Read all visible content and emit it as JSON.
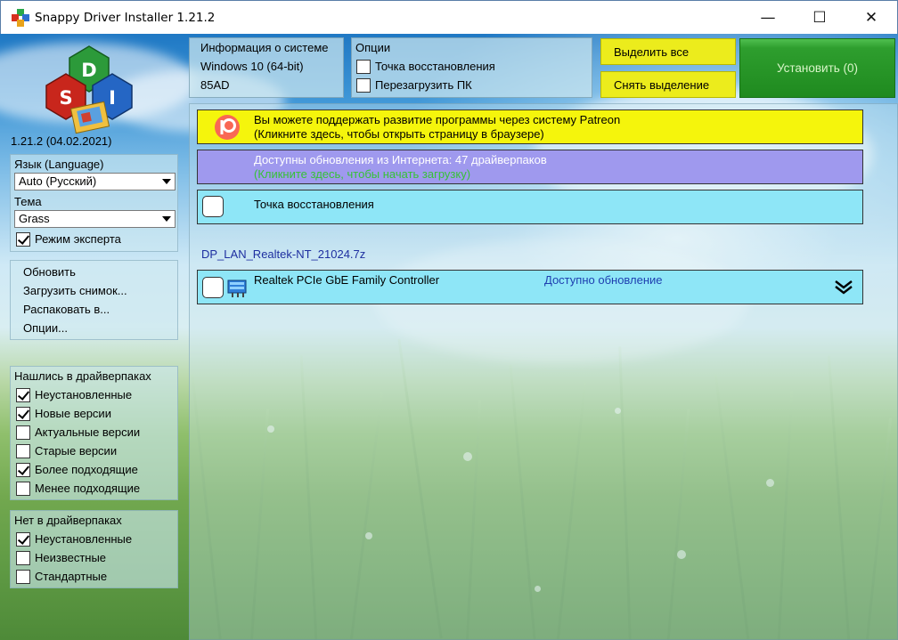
{
  "window": {
    "title": "Snappy Driver Installer 1.21.2"
  },
  "titlebar": {
    "minimize": "—",
    "maximize": "☐",
    "close": "✕"
  },
  "logo": {
    "letters": [
      "D",
      "S",
      "I"
    ]
  },
  "sidebar": {
    "version": "1.21.2 (04.02.2021)",
    "language_label": "Язык (Language)",
    "language_value": "Auto (Русский)",
    "theme_label": "Тема",
    "theme_value": "Grass",
    "expert_mode": "Режим эксперта",
    "menu": [
      "Обновить",
      "Загрузить снимок...",
      "Распаковать в...",
      "Опции..."
    ],
    "found_header": "Нашлись в драйверпаках",
    "found_filters": [
      {
        "label": "Неустановленные",
        "checked": true
      },
      {
        "label": "Новые версии",
        "checked": true
      },
      {
        "label": "Актуальные версии",
        "checked": false
      },
      {
        "label": "Старые версии",
        "checked": false
      },
      {
        "label": "Более подходящие",
        "checked": true
      },
      {
        "label": "Менее подходящие",
        "checked": false
      }
    ],
    "notfound_header": "Нет в драйверпаках",
    "notfound_filters": [
      {
        "label": "Неустановленные",
        "checked": true
      },
      {
        "label": "Неизвестные",
        "checked": false
      },
      {
        "label": "Стандартные",
        "checked": false
      }
    ]
  },
  "sysinfo": {
    "header": "Информация о системе",
    "os": "Windows 10 (64-bit)",
    "code": "85AD"
  },
  "options": {
    "header": "Опции",
    "restore_point": "Точка восстановления",
    "reboot": "Перезагрузить ПК"
  },
  "actions": {
    "select_all": "Выделить все",
    "deselect": "Снять выделение",
    "install": "Установить (0)"
  },
  "list": {
    "patreon_line1": "Вы можете поддержать развитие программы через систему Patreon",
    "patreon_line2": "(Кликните здесь, чтобы открыть страницу в браузере)",
    "updates_line1": "Доступны обновления из Интернета: 47 драйверпаков",
    "updates_line2": "(Кликните здесь, чтобы начать загрузку)",
    "restore_point": "Точка восстановления",
    "package_name": "DP_LAN_Realtek-NT_21024.7z",
    "driver_name": "Realtek PCIe GbE Family Controller",
    "driver_status": "Доступно обновление"
  },
  "colors": {
    "patreon_bg": "#f5f50c",
    "updates_bg": "#9f99ee",
    "row_bg": "#8ee6f7",
    "install_bg": "#1f8a1f",
    "button_yellow": "#ecec1c",
    "status_blue": "#1e3fb0",
    "updates_green": "#36c236"
  }
}
